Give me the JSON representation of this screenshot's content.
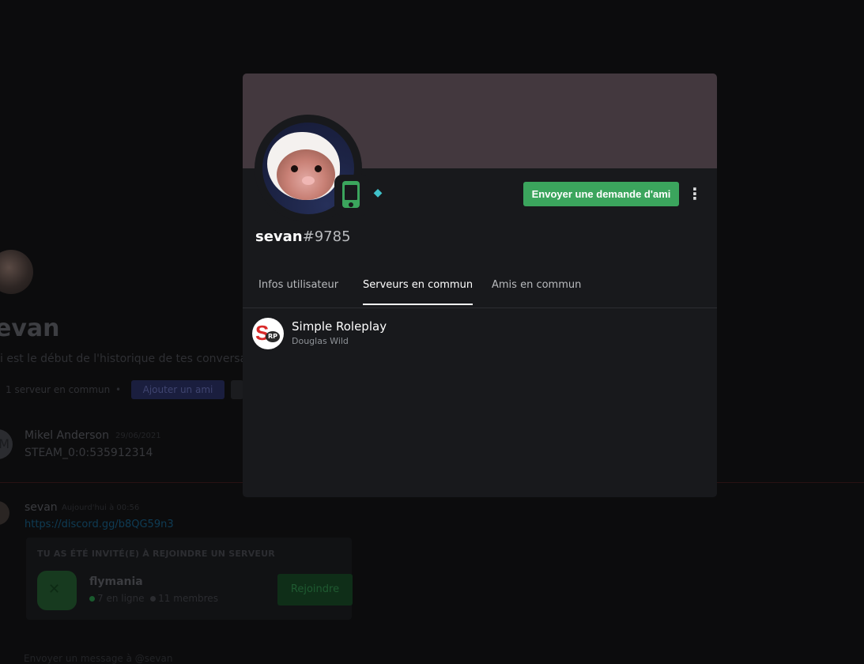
{
  "background": {
    "channel_title": "evan",
    "intro_text": "i est le début de l'historique de tes conversatio",
    "mutual_servers": "1 serveur en commun",
    "separator": "•",
    "add_friend_label": "Ajouter un ami",
    "messages": [
      {
        "author": "Mikel Anderson",
        "timestamp": "29/06/2021",
        "text": "STEAM_0:0:535912314",
        "avatar_letter": "M"
      },
      {
        "author": "sevan",
        "timestamp": "Aujourd'hui à 00:56",
        "text": "https://discord.gg/b8QG59n3"
      }
    ],
    "invite": {
      "heading": "TU AS ÉTÉ INVITÉ(E) À REJOINDRE UN SERVEUR",
      "server_name": "flymania",
      "online": "7 en ligne",
      "members": "11 membres",
      "join_label": "Rejoindre",
      "online_color": "#1a5a2e",
      "members_color": "#2b2c30"
    },
    "footer_text": "Envoyer un message à @sevan"
  },
  "profile": {
    "banner_color": "#43383e",
    "status": "mobile",
    "status_color": "#3ba55d",
    "badge_icon": "hypesquad-balance-icon",
    "badge_glyph": "◆",
    "username": "sevan",
    "discriminator": "#9785",
    "friend_request_label": "Envoyer une demande d'ami",
    "more_glyph": "⋮",
    "tabs": [
      {
        "label": "Infos utilisateur",
        "active": false
      },
      {
        "label": "Serveurs en commun",
        "active": true
      },
      {
        "label": "Amis en commun",
        "active": false
      }
    ],
    "mutual_servers": [
      {
        "name": "Simple Roleplay",
        "nickname": "Douglas Wild",
        "icon_letter": "S",
        "icon_sub": "RP"
      }
    ]
  }
}
